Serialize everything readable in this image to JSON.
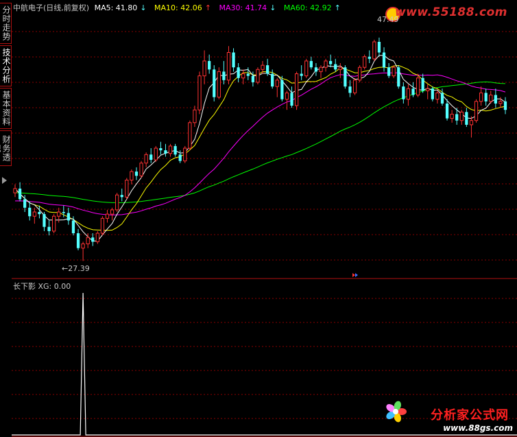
{
  "sidebar": {
    "tabs": [
      {
        "label": "分时走势",
        "active": false
      },
      {
        "label": "技术分析",
        "active": true
      },
      {
        "label": "基本资料",
        "active": false
      },
      {
        "label": "财务透视",
        "active": false
      }
    ]
  },
  "header": {
    "title": "中航电子(日线,前复权)",
    "ma5": "MA5: 41.80",
    "ma5_arrow": "↓",
    "ma10": "MA10: 42.06",
    "ma10_arrow": "↑",
    "ma30": "MA30: 41.74",
    "ma30_arrow": "↓",
    "ma60": "MA60: 42.92",
    "ma60_arrow": "↑"
  },
  "colors": {
    "up": "#ff3232",
    "down": "#54ffff",
    "ma5": "#ffffff",
    "ma10": "#ffff00",
    "ma30": "#ff00ff",
    "ma60": "#00ff00",
    "grid": "#8b0000"
  },
  "price_labels": {
    "low": "←27.39",
    "high": "47.49"
  },
  "indicator": {
    "label": "长下影",
    "value_label": "XG: 0.00"
  },
  "watermarks": {
    "top": "www.55188.com",
    "bottom_title": "分析家公式网",
    "bottom_url": "www.88gs.com"
  },
  "chart_data": {
    "type": "candlestick",
    "ylim": [
      26,
      50
    ],
    "low_value": 27.39,
    "high_value": 47.49,
    "candles": [
      [
        33.8,
        34.6,
        33.4,
        34.2
      ],
      [
        34.2,
        34.8,
        33.0,
        33.2
      ],
      [
        33.2,
        33.6,
        32.0,
        32.4
      ],
      [
        32.4,
        33.0,
        31.2,
        31.6
      ],
      [
        31.6,
        32.4,
        30.9,
        32.0
      ],
      [
        32.0,
        32.6,
        31.4,
        31.8
      ],
      [
        31.8,
        32.0,
        30.2,
        30.6
      ],
      [
        30.6,
        31.2,
        29.8,
        30.2
      ],
      [
        30.2,
        31.8,
        30.0,
        31.6
      ],
      [
        31.6,
        32.4,
        31.0,
        32.0
      ],
      [
        32.0,
        32.6,
        31.5,
        31.9
      ],
      [
        31.9,
        32.4,
        30.8,
        31.2
      ],
      [
        31.2,
        31.6,
        29.8,
        30.0
      ],
      [
        30.0,
        30.4,
        28.4,
        28.6
      ],
      [
        28.6,
        29.2,
        27.39,
        29.0
      ],
      [
        29.0,
        30.0,
        28.6,
        29.6
      ],
      [
        29.6,
        30.0,
        28.8,
        29.2
      ],
      [
        29.2,
        30.2,
        29.0,
        30.0
      ],
      [
        30.0,
        31.6,
        29.8,
        31.4
      ],
      [
        31.4,
        32.2,
        31.0,
        31.8
      ],
      [
        31.8,
        32.4,
        31.2,
        32.2
      ],
      [
        32.2,
        33.8,
        32.0,
        33.6
      ],
      [
        33.6,
        34.2,
        33.0,
        33.4
      ],
      [
        33.4,
        35.2,
        33.2,
        35.0
      ],
      [
        35.0,
        36.0,
        34.6,
        35.8
      ],
      [
        35.8,
        36.2,
        35.0,
        35.4
      ],
      [
        35.4,
        36.8,
        35.2,
        36.6
      ],
      [
        36.6,
        37.6,
        36.2,
        37.4
      ],
      [
        37.4,
        38.0,
        36.6,
        36.9
      ],
      [
        36.9,
        38.2,
        36.7,
        38.0
      ],
      [
        38.0,
        38.6,
        37.4,
        37.8
      ],
      [
        37.8,
        38.4,
        37.2,
        37.5
      ],
      [
        37.5,
        38.4,
        37.2,
        38.2
      ],
      [
        38.2,
        38.4,
        37.2,
        37.4
      ],
      [
        37.4,
        37.8,
        36.6,
        36.8
      ],
      [
        36.8,
        38.2,
        36.6,
        38.0
      ],
      [
        38.0,
        40.6,
        37.8,
        40.4
      ],
      [
        40.4,
        42.0,
        40.0,
        41.6
      ],
      [
        41.6,
        45.2,
        41.2,
        44.8
      ],
      [
        44.8,
        47.2,
        44.0,
        46.2
      ],
      [
        46.2,
        46.8,
        45.0,
        45.4
      ],
      [
        45.4,
        45.8,
        42.4,
        42.8
      ],
      [
        42.8,
        45.6,
        42.6,
        45.2
      ],
      [
        45.2,
        46.2,
        44.0,
        44.4
      ],
      [
        44.4,
        47.6,
        44.0,
        47.0
      ],
      [
        47.0,
        47.4,
        45.2,
        45.6
      ],
      [
        45.6,
        46.0,
        44.2,
        44.6
      ],
      [
        44.6,
        45.4,
        44.0,
        45.0
      ],
      [
        45.0,
        45.6,
        44.4,
        44.8
      ],
      [
        44.8,
        45.2,
        43.8,
        44.2
      ],
      [
        44.2,
        45.6,
        44.0,
        45.4
      ],
      [
        45.4,
        46.2,
        45.0,
        45.8
      ],
      [
        45.8,
        46.4,
        44.8,
        45.0
      ],
      [
        45.0,
        45.4,
        43.6,
        43.8
      ],
      [
        43.8,
        44.6,
        42.8,
        44.4
      ],
      [
        44.4,
        44.8,
        42.4,
        42.6
      ],
      [
        42.6,
        43.4,
        41.6,
        43.2
      ],
      [
        43.2,
        43.8,
        41.8,
        42.0
      ],
      [
        42.0,
        45.2,
        41.6,
        45.0
      ],
      [
        45.0,
        45.8,
        44.4,
        44.8
      ],
      [
        44.8,
        46.4,
        44.6,
        46.2
      ],
      [
        46.2,
        46.6,
        45.4,
        45.6
      ],
      [
        45.6,
        46.0,
        44.8,
        45.2
      ],
      [
        45.2,
        45.8,
        44.6,
        45.6
      ],
      [
        45.6,
        46.4,
        45.2,
        46.2
      ],
      [
        46.2,
        46.8,
        45.6,
        45.9
      ],
      [
        45.9,
        46.4,
        45.2,
        45.4
      ],
      [
        45.4,
        46.0,
        44.6,
        45.6
      ],
      [
        45.6,
        45.8,
        43.6,
        43.8
      ],
      [
        43.8,
        44.4,
        42.8,
        43.2
      ],
      [
        43.2,
        44.6,
        43.0,
        44.4
      ],
      [
        44.4,
        45.8,
        44.2,
        45.6
      ],
      [
        45.6,
        46.8,
        45.4,
        46.6
      ],
      [
        46.6,
        47.2,
        46.0,
        46.4
      ],
      [
        46.4,
        48.2,
        46.2,
        48.0
      ],
      [
        48.0,
        48.4,
        46.6,
        47.0
      ],
      [
        47.0,
        47.49,
        45.2,
        45.6
      ],
      [
        45.6,
        46.0,
        44.6,
        44.8
      ],
      [
        44.8,
        45.8,
        44.6,
        45.6
      ],
      [
        45.6,
        45.8,
        43.6,
        43.8
      ],
      [
        43.8,
        44.2,
        42.2,
        42.6
      ],
      [
        42.6,
        44.0,
        42.0,
        43.6
      ],
      [
        43.6,
        44.2,
        42.8,
        43.0
      ],
      [
        43.0,
        45.0,
        42.8,
        44.6
      ],
      [
        44.6,
        45.0,
        43.2,
        43.4
      ],
      [
        43.4,
        44.0,
        42.6,
        43.6
      ],
      [
        43.6,
        43.8,
        42.4,
        42.6
      ],
      [
        42.6,
        43.4,
        42.2,
        43.2
      ],
      [
        43.2,
        43.6,
        42.0,
        42.2
      ],
      [
        42.2,
        42.6,
        40.6,
        40.8
      ],
      [
        40.8,
        41.6,
        40.4,
        41.2
      ],
      [
        41.2,
        41.8,
        40.2,
        40.6
      ],
      [
        40.6,
        41.6,
        40.2,
        41.4
      ],
      [
        41.4,
        41.8,
        40.0,
        40.2
      ],
      [
        40.2,
        41.0,
        39.0,
        40.6
      ],
      [
        40.6,
        42.6,
        40.4,
        42.4
      ],
      [
        42.4,
        43.8,
        42.0,
        43.2
      ],
      [
        43.2,
        43.6,
        42.0,
        42.4
      ],
      [
        42.4,
        43.4,
        42.2,
        43.0
      ],
      [
        43.0,
        43.6,
        41.8,
        42.2
      ],
      [
        42.2,
        42.8,
        41.8,
        42.4
      ],
      [
        42.4,
        42.8,
        41.2,
        41.6
      ]
    ],
    "indicator": {
      "name": "XG",
      "values_nonzero_index": 14,
      "value_max": 1
    }
  }
}
